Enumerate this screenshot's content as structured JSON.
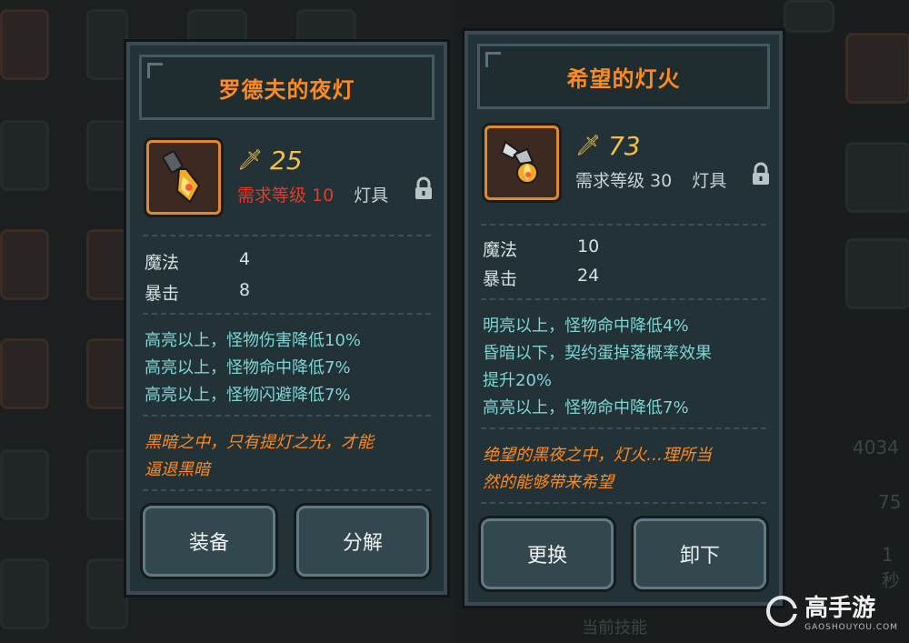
{
  "left_panel": {
    "title": "罗德夫的夜灯",
    "attack_icon": "sword-icon",
    "attack": "25",
    "required_level": "需求等级 10",
    "category": "灯具",
    "stats": [
      {
        "name": "魔法",
        "value": "4"
      },
      {
        "name": "暴击",
        "value": "8"
      }
    ],
    "effects": [
      "高亮以上，怪物伤害降低10%",
      "高亮以上，怪物命中降低7%",
      "高亮以上，怪物闪避降低7%"
    ],
    "flavor": [
      "黑暗之中，只有提灯之光，才能",
      "逼退黑暗"
    ],
    "buttons": {
      "equip": "装备",
      "dismantle": "分解"
    },
    "colors": {
      "required_level": "#e23a2c"
    }
  },
  "right_panel": {
    "title": "希望的灯火",
    "attack_icon": "sword-icon",
    "attack": "73",
    "required_level": "需求等级 30",
    "category": "灯具",
    "stats": [
      {
        "name": "魔法",
        "value": "10"
      },
      {
        "name": "暴击",
        "value": "24"
      }
    ],
    "effects": [
      "明亮以上，怪物命中降低4%",
      "昏暗以下，契约蛋掉落概率效果",
      "提升20%",
      "高亮以上，怪物命中降低7%"
    ],
    "flavor": [
      "绝望的黑夜之中，灯火…理所当",
      "然的能够带来希望"
    ],
    "buttons": {
      "replace": "更换",
      "unequip": "卸下"
    }
  },
  "background": {
    "right_values": [
      "4034",
      "75",
      "1秒"
    ],
    "bottom_label": "当前技能"
  },
  "watermark": {
    "name": "高手游",
    "url": "GAOSHOUYOU.COM"
  },
  "colors": {
    "title": "#ff8a1e",
    "attack": "#f2c14a",
    "effect": "#7fd4d4",
    "flavor": "#ff8a1e",
    "panel": "#223236"
  }
}
